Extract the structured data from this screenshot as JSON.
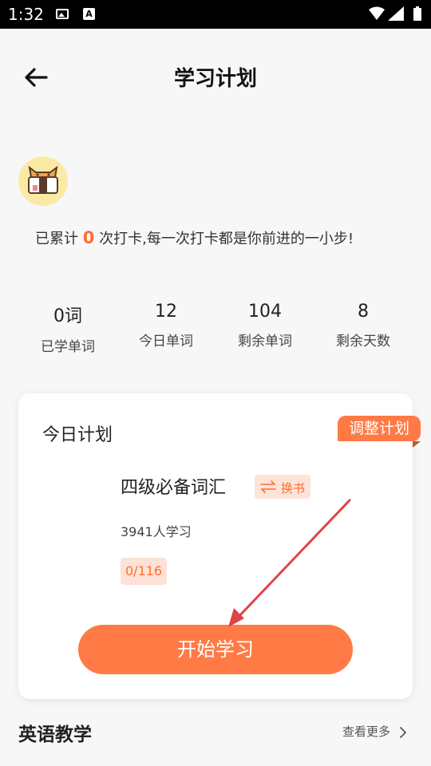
{
  "status_bar": {
    "time": "1:32",
    "icons": [
      "image-icon",
      "a-icon",
      "wifi-icon",
      "signal-icon",
      "battery-icon"
    ]
  },
  "header": {
    "title": "学习计划",
    "back_icon": "arrow-left-icon"
  },
  "checkin": {
    "prefix": "已累计",
    "count": "0",
    "suffix": "次打卡,每一次打卡都是你前进的一小步!"
  },
  "stats": [
    {
      "value": "0词",
      "label": "已学单词"
    },
    {
      "value": "12",
      "label": "今日单词"
    },
    {
      "value": "104",
      "label": "剩余单词"
    },
    {
      "value": "8",
      "label": "剩余天数"
    }
  ],
  "plan": {
    "title": "今日计划",
    "adjust_label": "调整计划",
    "book_name": "四级必备词汇",
    "swap_label": "换书",
    "learners": "3941人学习",
    "progress": "0/116",
    "start_label": "开始学习"
  },
  "section": {
    "title": "英语教学",
    "more_label": "查看更多"
  },
  "colors": {
    "accent": "#ff7a45",
    "accent_light": "#fde4d8",
    "arrow": "#e0434a"
  }
}
